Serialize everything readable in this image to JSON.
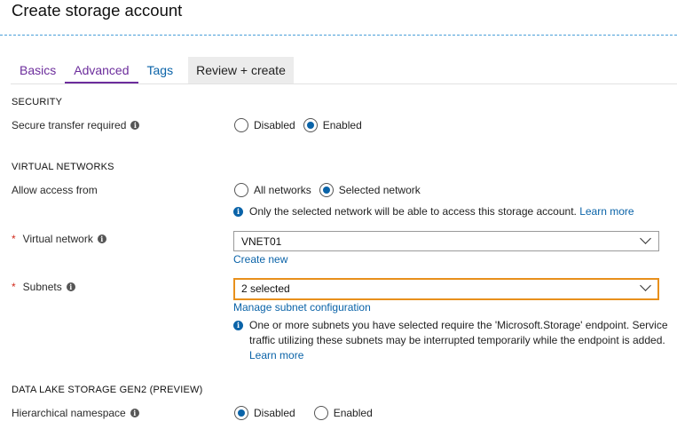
{
  "page": {
    "title": "Create storage account"
  },
  "tabs": [
    {
      "label": "Basics"
    },
    {
      "label": "Advanced"
    },
    {
      "label": "Tags"
    },
    {
      "label": "Review + create"
    }
  ],
  "security": {
    "heading": "SECURITY",
    "secure_transfer": {
      "label": "Secure transfer required",
      "options": [
        "Disabled",
        "Enabled"
      ],
      "selected": "Enabled"
    }
  },
  "virtual_networks": {
    "heading": "VIRTUAL NETWORKS",
    "allow_access": {
      "label": "Allow access from",
      "options": [
        "All networks",
        "Selected network"
      ],
      "selected": "Selected network",
      "note": "Only the selected network will be able to access this storage account.",
      "note_link": "Learn more"
    },
    "virtual_network": {
      "required_mark": "*",
      "label": "Virtual network",
      "value": "VNET01",
      "create_link": "Create new"
    },
    "subnets": {
      "required_mark": "*",
      "label": "Subnets",
      "value": "2 selected",
      "manage_link": "Manage subnet configuration",
      "note": "One or more subnets you have selected require the 'Microsoft.Storage' endpoint. Service traffic utilizing these subnets may be interrupted temporarily while the endpoint is added.",
      "note_link": "Learn more"
    }
  },
  "data_lake": {
    "heading": "DATA LAKE STORAGE GEN2 (PREVIEW)",
    "hierarchical_namespace": {
      "label": "Hierarchical namespace",
      "options": [
        "Disabled",
        "Enabled"
      ],
      "selected": "Disabled"
    }
  },
  "icons": {
    "info": "i"
  },
  "colors": {
    "accent": "#0a63a8",
    "visited_tab": "#6c2d9c",
    "highlight_border": "#e8901c",
    "required": "#d12a1c"
  }
}
